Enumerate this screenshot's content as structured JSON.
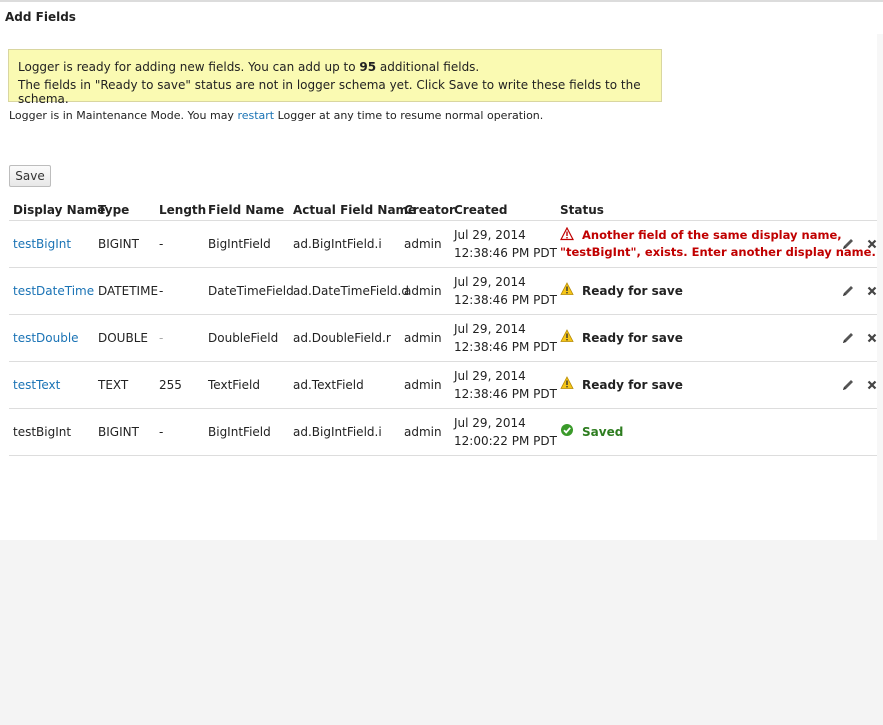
{
  "page": {
    "title": "Add Fields"
  },
  "notice": {
    "line1_prefix": "Logger is ready for adding new fields. You can add up to ",
    "line1_count": "95",
    "line1_suffix": " additional fields.",
    "line2": "The fields in \"Ready to save\" status are not in logger schema yet. Click Save to write these fields to the schema."
  },
  "maintenance": {
    "prefix": "Logger is in Maintenance Mode. You may ",
    "link": "restart",
    "suffix": " Logger at any time to resume normal operation."
  },
  "toolbar": {
    "save_label": "Save"
  },
  "table": {
    "headers": {
      "display_name": "Display Name",
      "type": "Type",
      "length": "Length",
      "field_name": "Field Name",
      "actual_field_name": "Actual Field Name",
      "creator": "Creator",
      "created": "Created",
      "status": "Status"
    },
    "rows": [
      {
        "display_name": "testBigInt",
        "type": "BIGINT",
        "length": "-",
        "field_name": "BigIntField",
        "actual_field_name": "ad.BigIntField.i",
        "creator": "admin",
        "created_date": "Jul 29, 2014",
        "created_time": "12:38:46 PM PDT",
        "status_line1": "Another field of the same display name,",
        "status_line2": "\"testBigInt\", exists. Enter another display name."
      },
      {
        "display_name": "testDateTime",
        "type": "DATETIME",
        "length": "-",
        "field_name": "DateTimeField",
        "actual_field_name": "ad.DateTimeField.d",
        "creator": "admin",
        "created_date": "Jul 29, 2014",
        "created_time": "12:38:46 PM PDT",
        "status": "Ready for save"
      },
      {
        "display_name": "testDouble",
        "type": "DOUBLE",
        "length": "-",
        "field_name": "DoubleField",
        "actual_field_name": "ad.DoubleField.r",
        "creator": "admin",
        "created_date": "Jul 29, 2014",
        "created_time": "12:38:46 PM PDT",
        "status": "Ready for save"
      },
      {
        "display_name": "testText",
        "type": "TEXT",
        "length": "255",
        "field_name": "TextField",
        "actual_field_name": "ad.TextField",
        "creator": "admin",
        "created_date": "Jul 29, 2014",
        "created_time": "12:38:46 PM PDT",
        "status": "Ready for save"
      },
      {
        "display_name": "testBigInt",
        "type": "BIGINT",
        "length": "-",
        "field_name": "BigIntField",
        "actual_field_name": "ad.BigIntField.i",
        "creator": "admin",
        "created_date": "Jul 29, 2014",
        "created_time": "12:00:22 PM PDT",
        "status": "Saved"
      }
    ]
  },
  "icons": {
    "error": "alert-triangle-icon",
    "warning": "warning-triangle-icon",
    "saved": "check-circle-icon",
    "edit": "pencil-icon",
    "delete": "close-icon"
  },
  "colors": {
    "link": "#1a73b5",
    "error": "#c00000",
    "saved": "#2e7d20",
    "notice_bg": "#fafab2"
  }
}
